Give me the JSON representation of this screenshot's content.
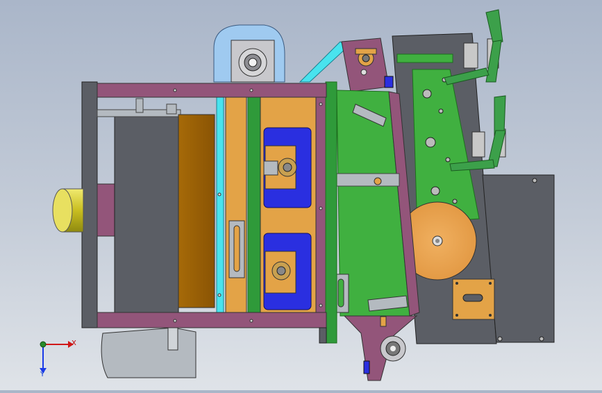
{
  "viewport": {
    "background_colors": [
      "#aab6c9",
      "#dfe3e8"
    ],
    "model_colors": {
      "frame_purple": "#93557a",
      "frame_green": "#2f9a3a",
      "bright_green": "#40b040",
      "orange": "#e3a347",
      "blue": "#2a2fe0",
      "dark_gray": "#5b5e65",
      "sheet_gray": "#b4bac0",
      "cyan": "#49e3ee",
      "yellow": "#d8d23c",
      "light_blue": "#9fcaf0"
    }
  },
  "triad": {
    "x_label": "X",
    "y_label": "Y",
    "x_color": "#d01818",
    "y_color": "#1a3ae8",
    "origin_color": "#2a8a2a"
  }
}
